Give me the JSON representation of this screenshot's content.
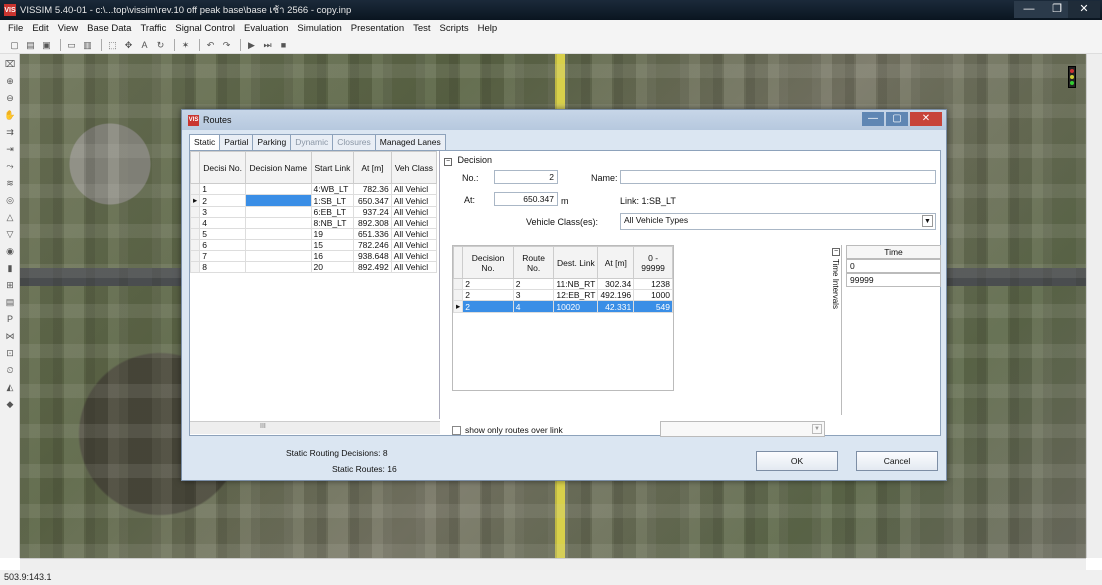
{
  "window": {
    "title": "VISSIM 5.40-01 - c:\\...top\\vissim\\rev.10  off peak base\\base เช้า 2566 - copy.inp",
    "app_icon_text": "VIS"
  },
  "menu": [
    "File",
    "Edit",
    "View",
    "Base Data",
    "Traffic",
    "Signal Control",
    "Evaluation",
    "Simulation",
    "Presentation",
    "Test",
    "Scripts",
    "Help"
  ],
  "status": {
    "coordinates": "503.9:143.1"
  },
  "dialog": {
    "title": "Routes",
    "tabs": [
      "Static",
      "Partial",
      "Parking",
      "Dynamic",
      "Closures",
      "Managed Lanes"
    ],
    "left_grid": {
      "headers": [
        "Decisi No.",
        "Decision Name",
        "Start Link",
        "At [m]",
        "Veh Class"
      ],
      "rows": [
        [
          "1",
          "",
          "4:WB_LT",
          "782.36",
          "All Vehicl"
        ],
        [
          "2",
          "",
          "1:SB_LT",
          "650.347",
          "All Vehicl"
        ],
        [
          "3",
          "",
          "6:EB_LT",
          "937.24",
          "All Vehicl"
        ],
        [
          "4",
          "",
          "8:NB_LT",
          "892.308",
          "All Vehicl"
        ],
        [
          "5",
          "",
          "19",
          "651.336",
          "All Vehicl"
        ],
        [
          "6",
          "",
          "15",
          "782.246",
          "All Vehicl"
        ],
        [
          "7",
          "",
          "16",
          "938.648",
          "All Vehicl"
        ],
        [
          "8",
          "",
          "20",
          "892.492",
          "All Vehicl"
        ]
      ],
      "scroll_label": "III"
    },
    "decision": {
      "section_label": "Decision",
      "no_label": "No.:",
      "no_value": "2",
      "name_label": "Name:",
      "name_value": "",
      "at_label": "At:",
      "at_value": "650.347",
      "at_unit": "m",
      "link_text": "Link: 1:SB_LT",
      "vehicle_class_label": "Vehicle Class(es):",
      "vehicle_class_value": "All Vehicle Types"
    },
    "routes_table": {
      "headers": [
        "Decision No.",
        "Route No.",
        "Dest. Link",
        "At [m]",
        "0 - 99999"
      ],
      "rows": [
        [
          "2",
          "2",
          "11:NB_RT",
          "302.34",
          "1238"
        ],
        [
          "2",
          "3",
          "12:EB_RT",
          "492.196",
          "1000"
        ],
        [
          "2",
          "4",
          "10020",
          "42.331",
          "549"
        ]
      ]
    },
    "time_intervals": {
      "side_label": "Time Intervals",
      "header": "Time",
      "values": [
        "0",
        "99999"
      ]
    },
    "show_only_label": "show only routes over link",
    "stats": {
      "decisions": "Static Routing Decisions:  8",
      "routes": "Static Routes:  16"
    },
    "ok_label": "OK",
    "cancel_label": "Cancel"
  }
}
